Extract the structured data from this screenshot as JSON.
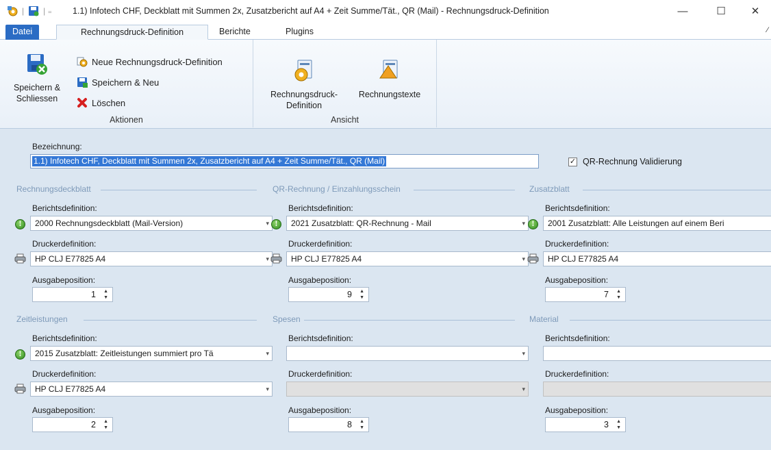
{
  "window": {
    "title": "1.1) Infotech CHF, Deckblatt mit Summen 2x, Zusatzbericht auf A4 + Zeit Summe/Tät., QR (Mail) - Rechnungsdruck-Definition",
    "minimize": "—",
    "maximize": "☐",
    "close": "✕",
    "qa_separator": "|  ="
  },
  "tabs": {
    "file": "Datei",
    "active": "Rechnungsdruck-Definition",
    "reports": "Berichte",
    "plugins": "Plugins",
    "pin": "⌂"
  },
  "ribbon": {
    "save_close": "Speichern & Schliessen",
    "new_definition": "Neue Rechnungsdruck-Definition",
    "save_new": "Speichern & Neu",
    "delete": "Löschen",
    "group_actions": "Aktionen",
    "view_definition": "Rechnungsdruck-Definition",
    "view_texts": "Rechnungstexte",
    "group_view": "Ansicht"
  },
  "form": {
    "bezeichnung_label": "Bezeichnung:",
    "bezeichnung_value": "1.1) Infotech CHF, Deckblatt mit Summen 2x, Zusatzbericht auf A4 + Zeit Summe/Tät., QR (Mail)",
    "qr_validate_label": "QR-Rechnung Validierung",
    "qr_validate_checked": "✓"
  },
  "sections": [
    {
      "title": "Rechnungsdeckblatt",
      "report_label": "Berichtsdefinition:",
      "report_value": "2000 Rechnungsdeckblatt (Mail-Version)",
      "printer_label": "Druckerdefinition:",
      "printer_value": "HP CLJ E77825 A4",
      "position_label": "Ausgabeposition:",
      "position_value": "1"
    },
    {
      "title": "QR-Rechnung / Einzahlungsschein",
      "report_label": "Berichtsdefinition:",
      "report_value": "2021 Zusatzblatt: QR-Rechnung - Mail",
      "printer_label": "Druckerdefinition:",
      "printer_value": "HP CLJ E77825 A4",
      "position_label": "Ausgabeposition:",
      "position_value": "9"
    },
    {
      "title": "Zusatzblatt",
      "report_label": "Berichtsdefinition:",
      "report_value": "2001 Zusatzblatt: Alle Leistungen auf einem Beri",
      "printer_label": "Druckerdefinition:",
      "printer_value": "HP CLJ E77825 A4",
      "position_label": "Ausgabeposition:",
      "position_value": "7"
    },
    {
      "title": "Zeitleistungen",
      "report_label": "Berichtsdefinition:",
      "report_value": "2015 Zusatzblatt: Zeitleistungen summiert pro Tä",
      "printer_label": "Druckerdefinition:",
      "printer_value": "HP CLJ E77825 A4",
      "position_label": "Ausgabeposition:",
      "position_value": "2"
    },
    {
      "title": "Spesen",
      "report_label": "Berichtsdefinition:",
      "report_value": "",
      "printer_label": "Druckerdefinition:",
      "printer_value": "",
      "position_label": "Ausgabeposition:",
      "position_value": "8"
    },
    {
      "title": "Material",
      "report_label": "Berichtsdefinition:",
      "report_value": "",
      "printer_label": "Druckerdefinition:",
      "printer_value": "",
      "position_label": "Ausgabeposition:",
      "position_value": "3"
    }
  ],
  "glyphs": {
    "combo_arrow": "▾",
    "spin": "▲\n▼",
    "info": "!"
  }
}
